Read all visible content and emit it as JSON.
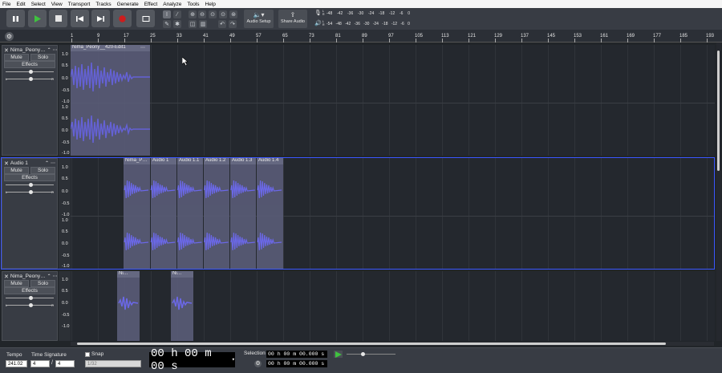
{
  "menu": [
    "File",
    "Edit",
    "Select",
    "View",
    "Transport",
    "Tracks",
    "Generate",
    "Effect",
    "Analyze",
    "Tools",
    "Help"
  ],
  "toolbar": {
    "audio_setup_label": "Audio Setup",
    "share_audio_label": "Share Audio",
    "meter_ticks_record": [
      "-48",
      "-42",
      "-36",
      "-30",
      "-24",
      "-18",
      "-12",
      "-6",
      "0"
    ],
    "meter_ticks_play": [
      "-54",
      "-48",
      "-42",
      "-36",
      "-30",
      "-24",
      "-18",
      "-12",
      "-6",
      "0"
    ],
    "record_meter_label": "L R",
    "play_meter_label": "L R"
  },
  "ruler": {
    "labels": [
      "1",
      "9",
      "17",
      "25",
      "33",
      "41",
      "49",
      "57",
      "65",
      "73",
      "81",
      "89",
      "97",
      "105",
      "113",
      "121",
      "129",
      "137",
      "145",
      "153",
      "161",
      "169",
      "177",
      "185",
      "193"
    ]
  },
  "tracks": [
    {
      "name": "Nima_Peony…",
      "mute": "Mute",
      "solo": "Solo",
      "effects": "Effects",
      "pan_l": "L",
      "pan_r": "R",
      "scale_top": [
        "1.0",
        "0.5",
        "0.0",
        "-0.5",
        "-1.0"
      ],
      "scale_bottom": [
        "1.0",
        "0.5",
        "0.0",
        "-0.5",
        "-1.0"
      ],
      "clips": [
        {
          "name": "Nima_Peony__420-Edit1",
          "menu": "⋯"
        }
      ]
    },
    {
      "name": "Audio 1",
      "mute": "Mute",
      "solo": "Solo",
      "effects": "Effects",
      "pan_l": "L",
      "pan_r": "R",
      "scale_top": [
        "1.0",
        "0.5",
        "0.0",
        "-0.5",
        "-1.0"
      ],
      "scale_bottom": [
        "1.0",
        "0.5",
        "0.0",
        "-0.5",
        "-1.0"
      ],
      "clips": [
        {
          "name": "Nima_P…"
        },
        {
          "name": "Audio 1"
        },
        {
          "name": "Audio 1.1"
        },
        {
          "name": "Audio 1.2"
        },
        {
          "name": "Audio 1.3"
        },
        {
          "name": "Audio 1.4"
        }
      ]
    },
    {
      "name": "Nima_Peony…",
      "mute": "Mute",
      "solo": "Solo",
      "effects": "Effects",
      "pan_l": "L",
      "pan_r": "R",
      "scale_top": [
        "1.0",
        "0.5",
        "0.0",
        "-0.5",
        "-1.0"
      ],
      "clips": [
        {
          "name": "Ni…"
        },
        {
          "name": "Ni…"
        }
      ]
    }
  ],
  "bottom": {
    "tempo_label": "Tempo",
    "tempo_value": "241.02",
    "time_sig_label": "Time Signature",
    "time_sig_num": "4",
    "time_sig_den": "4",
    "snap_label": "Snap",
    "snap_value": "1/32",
    "time_display": "00 h 00 m 00 s",
    "selection_label": "Selection",
    "selection_start": "00 h 00 m 00.000 s",
    "selection_end": "00 h 00 m 00.000 s"
  },
  "colors": {
    "accent_selection": "#3b57ff",
    "play_green": "#3fc23f",
    "record_red": "#cc1d1d",
    "waveform": "#6b68e8"
  }
}
